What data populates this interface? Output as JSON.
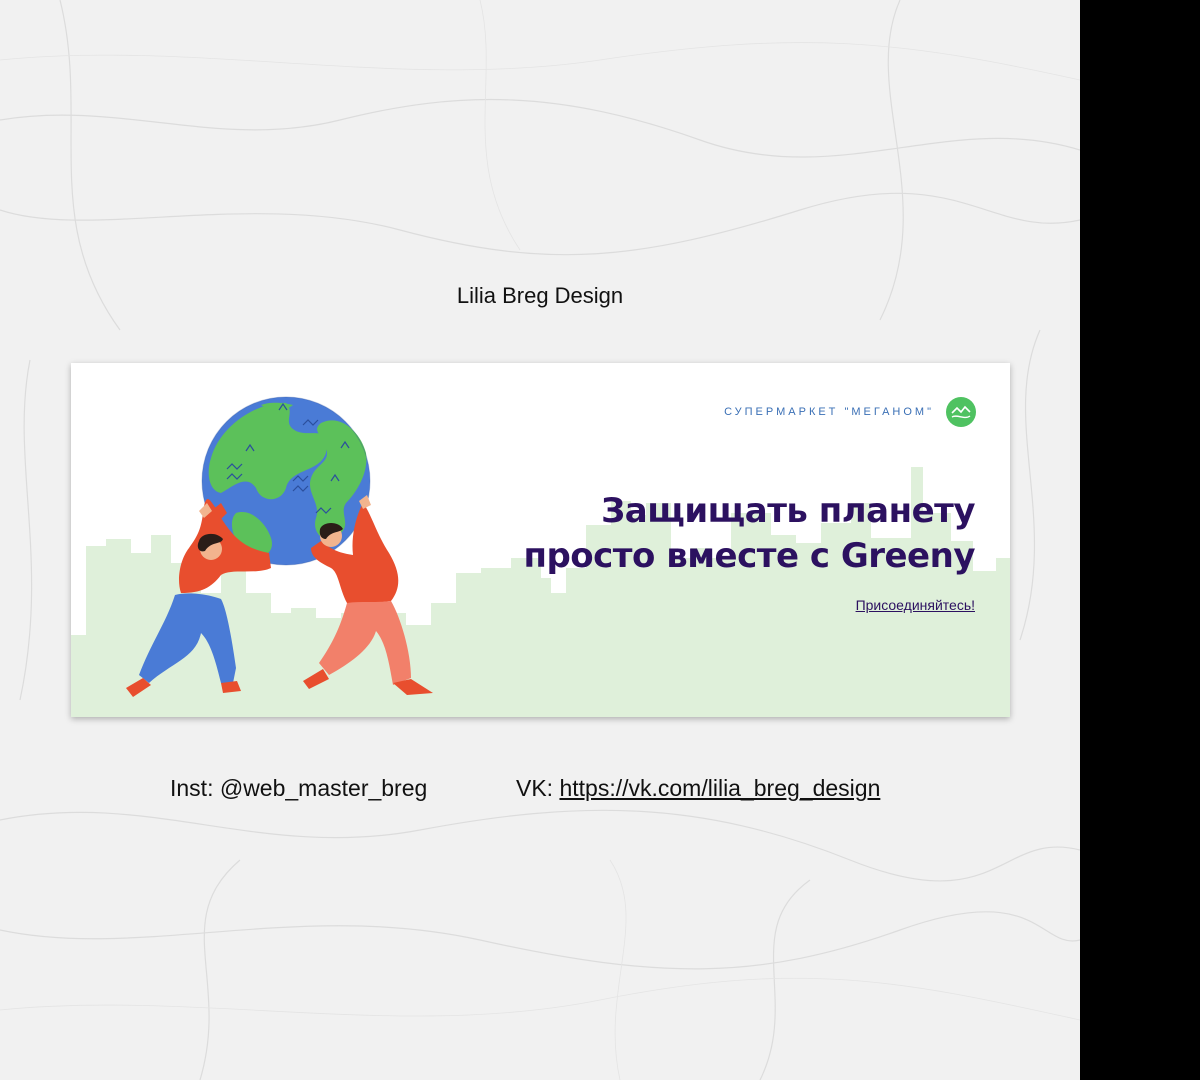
{
  "author": {
    "title": "Lilia Breg Design"
  },
  "banner": {
    "brand": "СУПЕРМАРКЕТ \"МЕГАНОМ\"",
    "headline_line1": "Защищать планету",
    "headline_line2": "просто вместе с Greeny",
    "cta": "Присоединяйтесь!",
    "colors": {
      "headline": "#2c1160",
      "brand_text": "#3a6fb5",
      "skyline": "#dff0da",
      "logo": "#4fc261"
    },
    "illustration": {
      "icon": "globe-icon",
      "figures": [
        "woman-kneeling",
        "man-kneeling"
      ]
    }
  },
  "contacts": {
    "inst": "Inst: @web_master_breg",
    "vk_prefix": "VK: ",
    "vk_link": "https://vk.com/lilia_breg_design"
  },
  "colors": {
    "page_bg": "#f1f1f1",
    "right_strip": "#000000"
  }
}
